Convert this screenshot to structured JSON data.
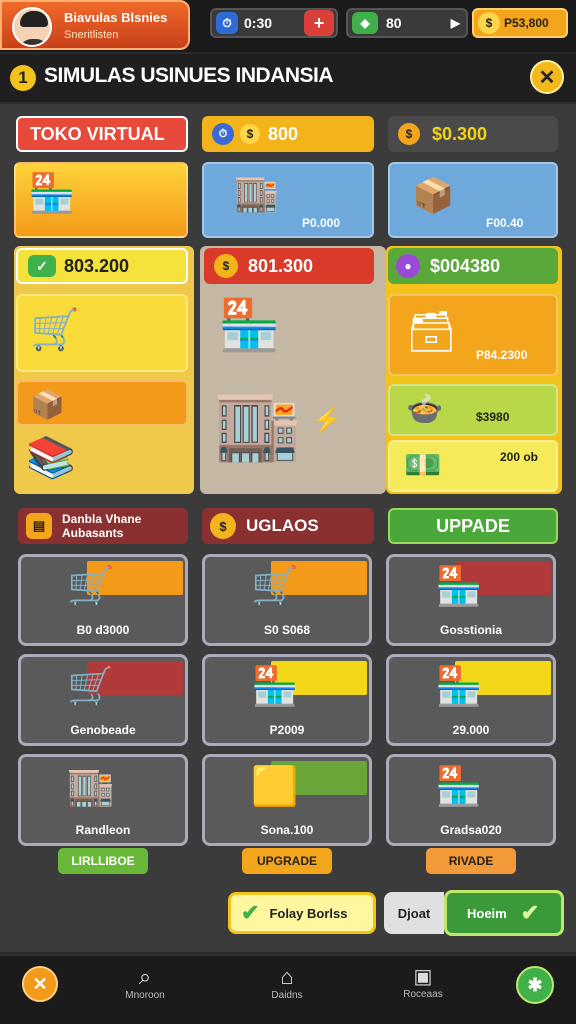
{
  "player": {
    "name": "Biavulas Blsnies",
    "subtitle": "Sneritlisten"
  },
  "hud": {
    "timer": "0:30",
    "gems": "80",
    "cash": "P53,800"
  },
  "title": "SIMULAS USINUES INDANSIA",
  "header": {
    "toko": "TOKO VIRTUAL",
    "money1": "800",
    "money2": "$0.300"
  },
  "cards_top": [
    {
      "price": "P0.000"
    },
    {
      "price": "F00.40"
    }
  ],
  "row2": {
    "a": "803.200",
    "b": "801.300",
    "c": "$004380"
  },
  "right_prices": [
    "P84.2300",
    "$3980",
    "200 ob"
  ],
  "section": {
    "left": "Danbla Vhane Aubasants",
    "mid": "UGLAOS",
    "right": "UPPADE"
  },
  "grid": [
    {
      "label": "B0 d3000",
      "bar": "#f39a1a"
    },
    {
      "label": "S0 S068",
      "bar": "#f39a1a"
    },
    {
      "label": "Gosstionia",
      "bar": "#b03a3a"
    },
    {
      "label": "Genobeade",
      "bar": "#b03a3a"
    },
    {
      "label": "P2009",
      "bar": "#f3d81a"
    },
    {
      "label": "29.000",
      "bar": "#f3d81a"
    },
    {
      "label": "Randleon",
      "bar": "#5a5a5a"
    },
    {
      "label": "Sona.100",
      "bar": "#6aa53a"
    },
    {
      "label": "Gradsa020",
      "bar": "#5a5a5a"
    }
  ],
  "buttons": {
    "b1": "LIRLLIBOE",
    "b2": "UPGRADE",
    "b3": "RIVADE"
  },
  "bottom": {
    "confirm": "Folay Borlss",
    "quiet": "Djoat",
    "upgrade": "Hoeim"
  },
  "nav": [
    "Mnoroon",
    "Daidns",
    "Roceaas"
  ]
}
